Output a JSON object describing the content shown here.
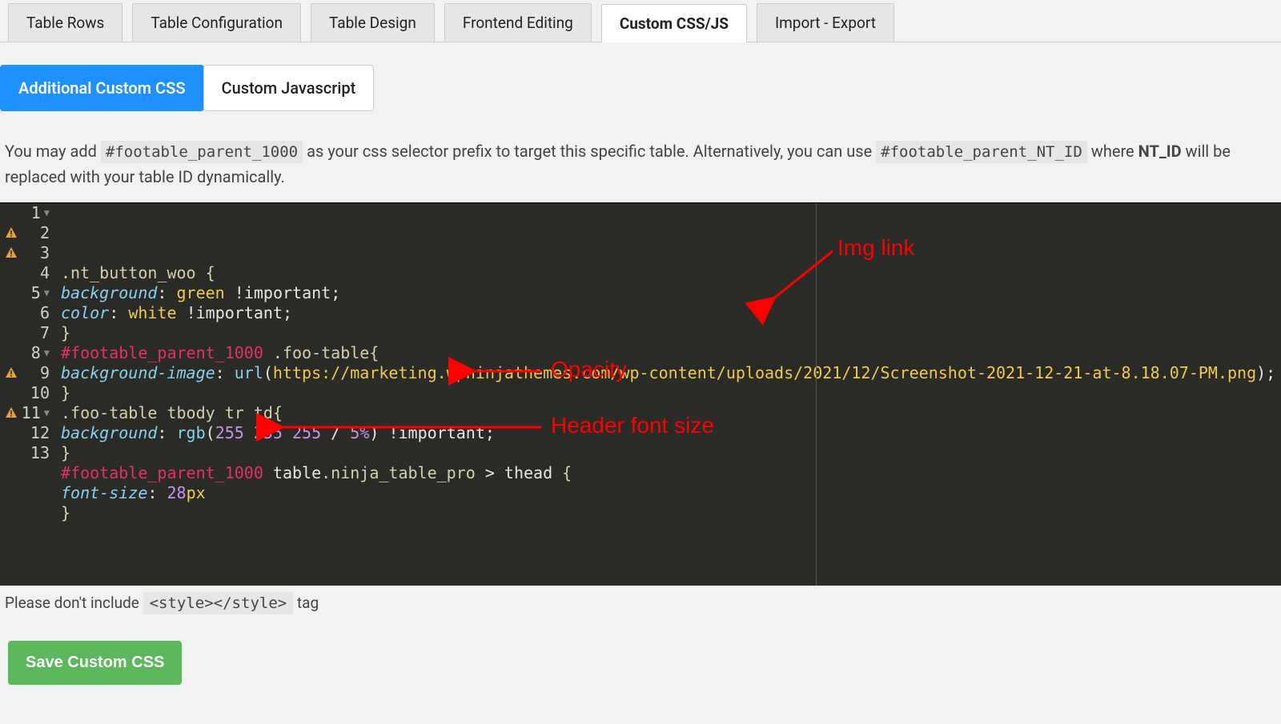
{
  "top_tabs": [
    {
      "label": "Table Rows",
      "active": false
    },
    {
      "label": "Table Configuration",
      "active": false
    },
    {
      "label": "Table Design",
      "active": false
    },
    {
      "label": "Frontend Editing",
      "active": false
    },
    {
      "label": "Custom CSS/JS",
      "active": true
    },
    {
      "label": "Import - Export",
      "active": false
    }
  ],
  "sub_tabs": [
    {
      "label": "Additional Custom CSS",
      "active": true
    },
    {
      "label": "Custom Javascript",
      "active": false
    }
  ],
  "hint": {
    "pre": "You may add ",
    "code1": "#footable_parent_1000",
    "mid1": " as your css selector prefix to target this specific table. Alternatively, you can use ",
    "code2": "#footable_parent_NT_ID",
    "mid2": " where ",
    "bold": "NT_ID",
    "post": " will be replaced with your table ID dynamically."
  },
  "editor": {
    "lines": [
      {
        "n": 1,
        "fold": true,
        "warn": false,
        "tokens": [
          [
            "sel",
            ".nt_button_woo "
          ],
          [
            "brace",
            "{"
          ]
        ]
      },
      {
        "n": 2,
        "fold": false,
        "warn": true,
        "tokens": [
          [
            "prop",
            "background"
          ],
          [
            "punc",
            ": "
          ],
          [
            "col",
            "green"
          ],
          [
            "white",
            " !important"
          ],
          [
            "punc",
            ";"
          ]
        ]
      },
      {
        "n": 3,
        "fold": false,
        "warn": true,
        "tokens": [
          [
            "prop",
            "color"
          ],
          [
            "punc",
            ": "
          ],
          [
            "col",
            "white"
          ],
          [
            "white",
            " !important"
          ],
          [
            "punc",
            ";"
          ]
        ]
      },
      {
        "n": 4,
        "fold": false,
        "warn": false,
        "tokens": [
          [
            "brace",
            "}"
          ]
        ]
      },
      {
        "n": 5,
        "fold": true,
        "warn": false,
        "tokens": [
          [
            "id",
            "#footable_parent_1000 "
          ],
          [
            "sel",
            ".foo-table"
          ],
          [
            "brace",
            "{"
          ]
        ]
      },
      {
        "n": 6,
        "fold": false,
        "warn": false,
        "tokens": [
          [
            "prop",
            "background-image"
          ],
          [
            "punc",
            ": "
          ],
          [
            "func",
            "url"
          ],
          [
            "punc",
            "("
          ],
          [
            "url",
            "https://marketing.wpninjathemes.com/wp-content/uploads/2021/12/Screenshot-2021-12-21-at-8.18.07-PM.png"
          ],
          [
            "punc",
            ")"
          ],
          [
            "punc",
            ";"
          ]
        ]
      },
      {
        "n": 7,
        "fold": false,
        "warn": false,
        "tokens": [
          [
            "brace",
            "}"
          ]
        ]
      },
      {
        "n": 8,
        "fold": true,
        "warn": false,
        "tokens": [
          [
            "sel",
            ".foo-table tbody tr td"
          ],
          [
            "brace",
            "{"
          ]
        ]
      },
      {
        "n": 9,
        "fold": false,
        "warn": true,
        "tokens": [
          [
            "prop",
            "background"
          ],
          [
            "punc",
            ": "
          ],
          [
            "func",
            "rgb"
          ],
          [
            "punc",
            "("
          ],
          [
            "num",
            "255 255 255"
          ],
          [
            "white",
            " / "
          ],
          [
            "num",
            "5%"
          ],
          [
            "punc",
            ")"
          ],
          [
            "white",
            " !important"
          ],
          [
            "punc",
            ";"
          ]
        ]
      },
      {
        "n": 10,
        "fold": false,
        "warn": false,
        "tokens": [
          [
            "brace",
            "}"
          ]
        ]
      },
      {
        "n": 11,
        "fold": true,
        "warn": true,
        "tokens": [
          [
            "id",
            "#footable_parent_1000 "
          ],
          [
            "white",
            "table"
          ],
          [
            "sel",
            ".ninja_table_pro"
          ],
          [
            "white",
            " > thead "
          ],
          [
            "brace",
            "{"
          ]
        ]
      },
      {
        "n": 12,
        "fold": false,
        "warn": false,
        "tokens": [
          [
            "prop",
            "font-size"
          ],
          [
            "punc",
            ": "
          ],
          [
            "num",
            "28"
          ],
          [
            "col",
            "px"
          ]
        ]
      },
      {
        "n": 13,
        "fold": false,
        "warn": false,
        "tokens": [
          [
            "brace",
            "}"
          ]
        ]
      }
    ]
  },
  "annotations": [
    {
      "label": "Img link"
    },
    {
      "label": "Opacity"
    },
    {
      "label": "Header font size"
    }
  ],
  "foot_note": {
    "pre": "Please don't include ",
    "code": "<style></style>",
    "post": " tag"
  },
  "save_button": "Save Custom CSS"
}
